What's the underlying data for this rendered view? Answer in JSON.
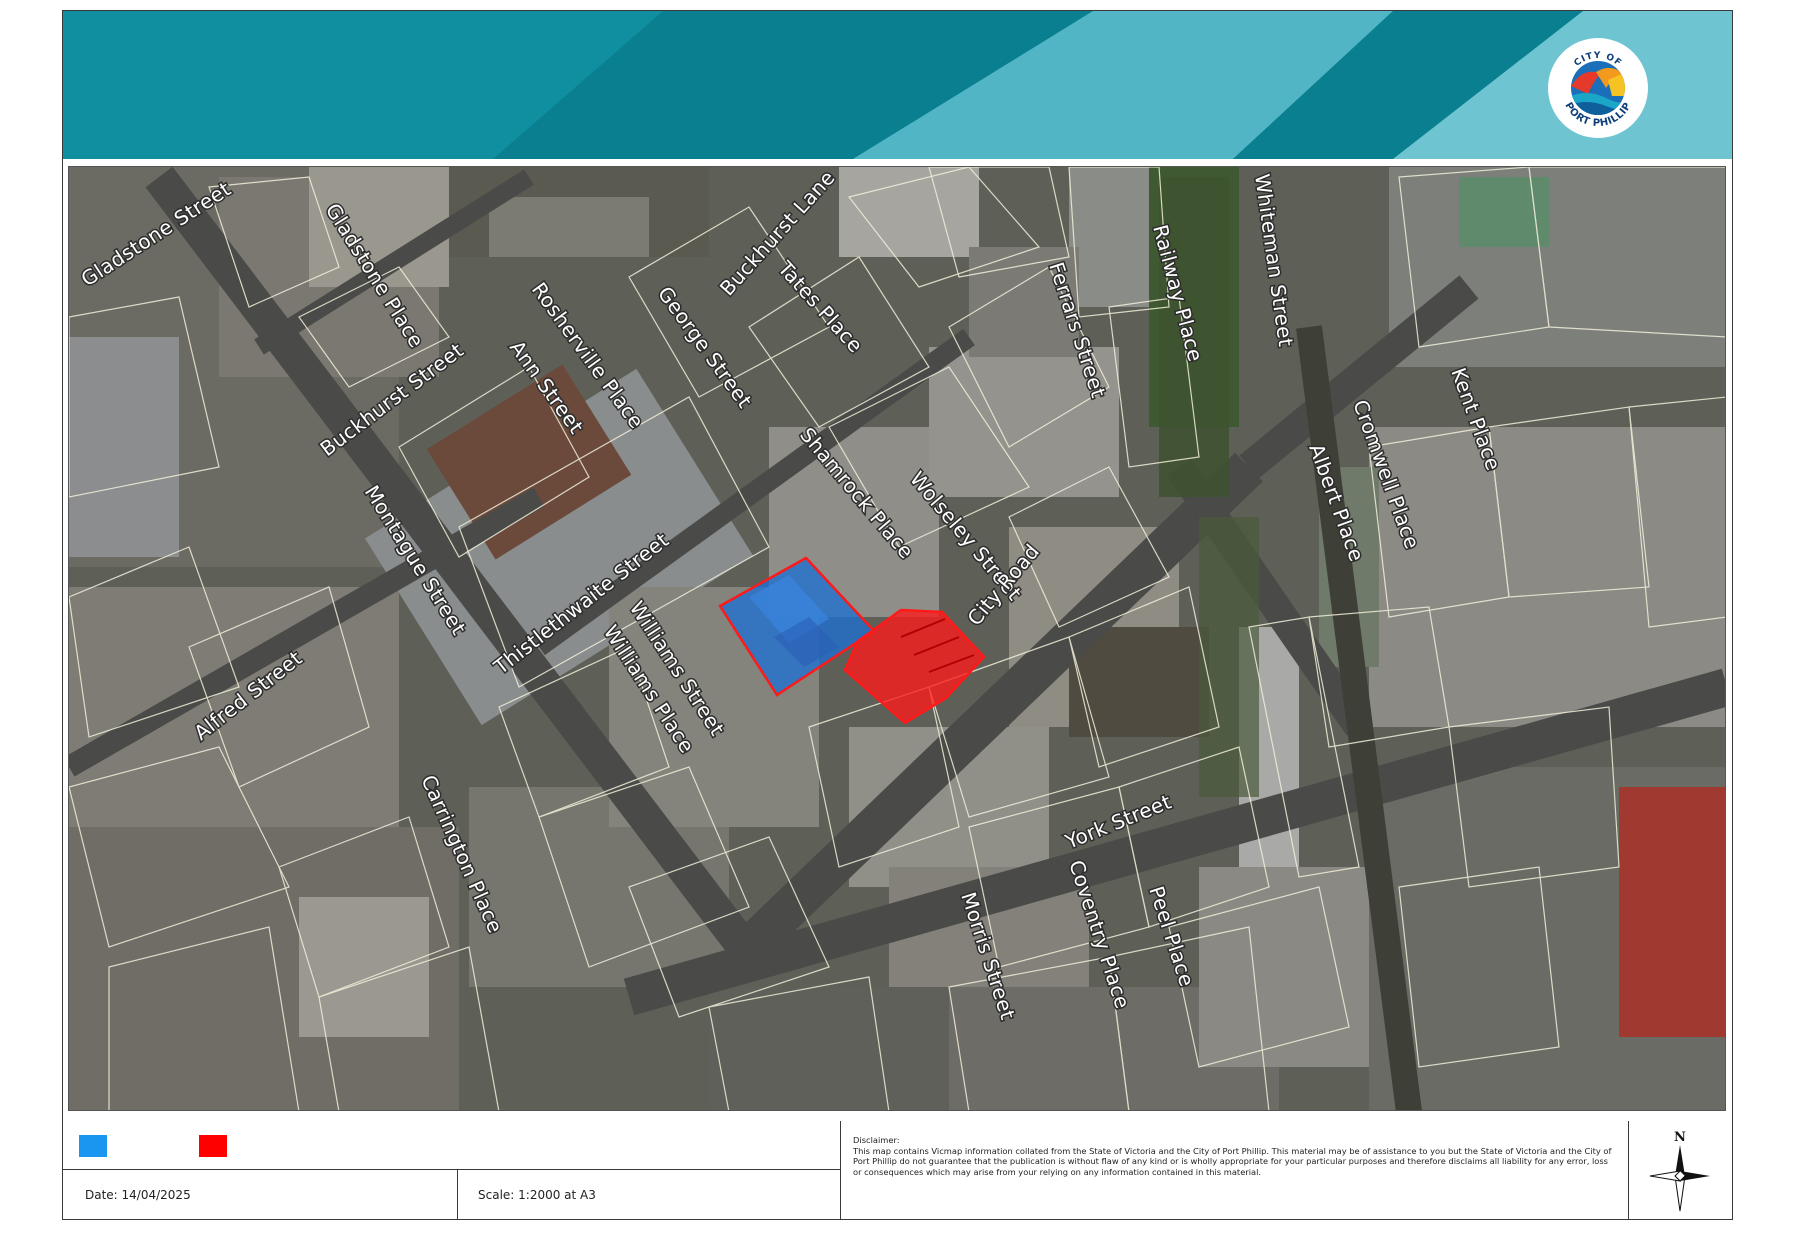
{
  "banner": {
    "colors": {
      "base": "#0f8fa0",
      "dark": "#0a7f8f",
      "light": "#52b5c5",
      "pale": "#6fc4d1"
    },
    "logo": {
      "name": "city-of-port-phillip-logo",
      "text_top": "CITY OF",
      "text_bottom": "PORT PHILLIP"
    }
  },
  "map": {
    "streets": [
      {
        "id": "gladstone-street",
        "label": "Gladstone Street"
      },
      {
        "id": "gladstone-place",
        "label": "Gladstone Place"
      },
      {
        "id": "buckhurst-lane",
        "label": "Buckhurst Lane"
      },
      {
        "id": "tates-place",
        "label": "Tates Place"
      },
      {
        "id": "rosherville-place",
        "label": "Rosherville Place"
      },
      {
        "id": "george-street",
        "label": "George Street"
      },
      {
        "id": "ann-street",
        "label": "Ann Street"
      },
      {
        "id": "buckhurst-street",
        "label": "Buckhurst Street"
      },
      {
        "id": "ferrars-street",
        "label": "Ferrars Street"
      },
      {
        "id": "railway-place",
        "label": "Railway Place"
      },
      {
        "id": "whiteman-street",
        "label": "Whiteman Street"
      },
      {
        "id": "kent-place",
        "label": "Kent Place"
      },
      {
        "id": "cromwell-place",
        "label": "Cromwell Place"
      },
      {
        "id": "albert-place",
        "label": "Albert Place"
      },
      {
        "id": "shamrock-place",
        "label": "Shamrock Place"
      },
      {
        "id": "wolseley-street",
        "label": "Wolseley Street"
      },
      {
        "id": "city-road",
        "label": "City Road"
      },
      {
        "id": "montague-street",
        "label": "Montague Street"
      },
      {
        "id": "thistlethwaite-street",
        "label": "Thistlethwaite Street"
      },
      {
        "id": "williams-street",
        "label": "Williams Street"
      },
      {
        "id": "williams-place",
        "label": "Williams Place"
      },
      {
        "id": "alfred-street",
        "label": "Alfred Street"
      },
      {
        "id": "carrington-place",
        "label": "Carrington Place"
      },
      {
        "id": "york-street",
        "label": "York Street"
      },
      {
        "id": "morris-street",
        "label": "Morris Street"
      },
      {
        "id": "coventry-place",
        "label": "Coventry Place"
      },
      {
        "id": "peel-place",
        "label": "Peel Place"
      }
    ],
    "highlight_colors": {
      "blue": "#1f6fd1",
      "red": "#ff1a1a"
    }
  },
  "legend": {
    "items": [
      {
        "name": "blue-legend-swatch",
        "color": "#1a96f0",
        "label": ""
      },
      {
        "name": "red-legend-swatch",
        "color": "#ff0000",
        "label": ""
      }
    ],
    "date": "Date: 14/04/2025",
    "scale": "Scale: 1:2000 at A3",
    "disclaimer_title": "Disclaimer:",
    "disclaimer_text": "This map contains Vicmap information collated from the State of Victoria and the City of Port Phillip. This material may be of assistance to you but the State of Victoria and the City of Port Phillip do not guarantee that the publication is without flaw of any kind or is wholly appropriate for your particular purposes and therefore disclaims all liability for any error, loss or consequences which may arise from your relying on any information contained in this material.",
    "north_label": "N"
  }
}
